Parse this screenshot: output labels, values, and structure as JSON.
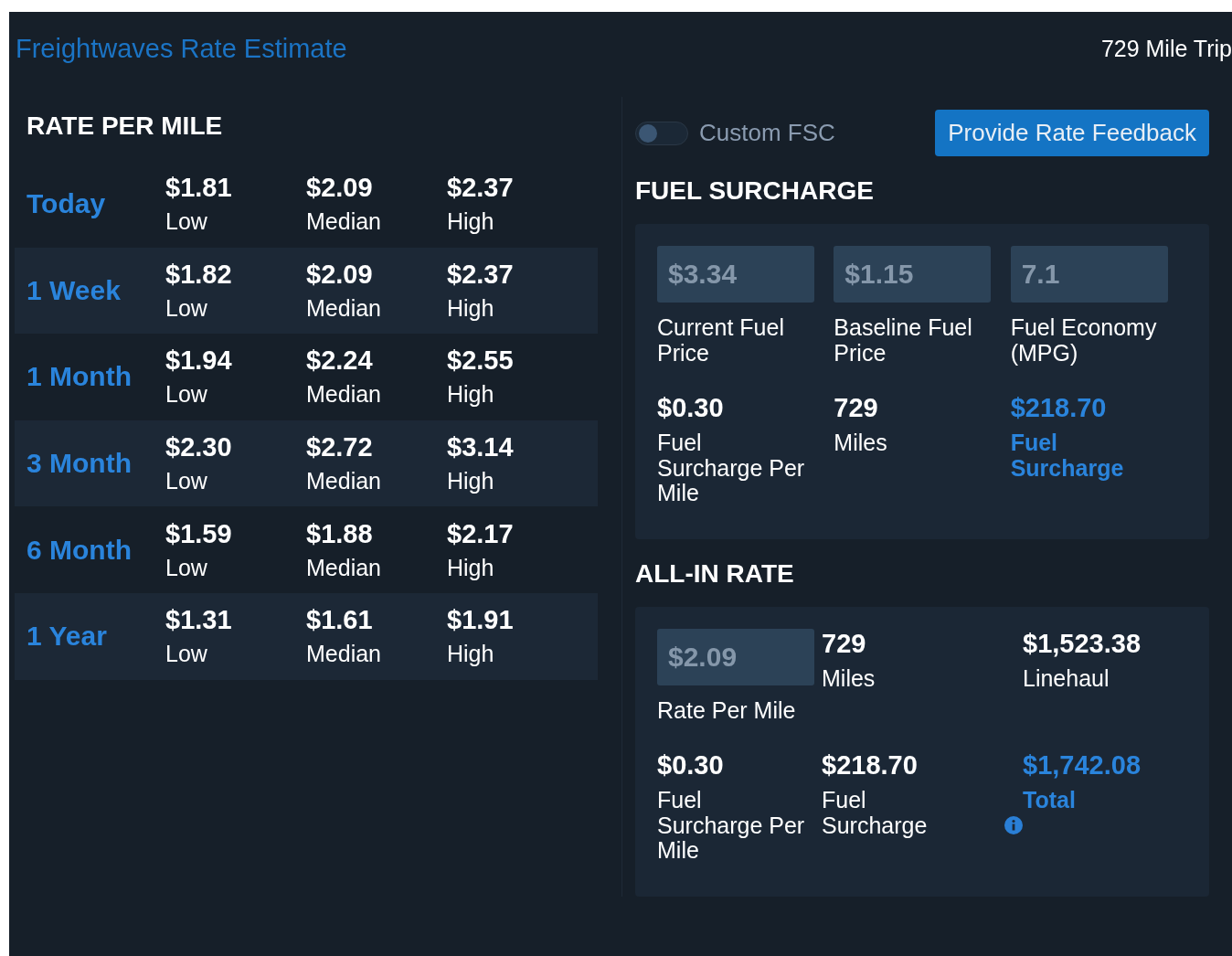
{
  "header": {
    "title": "Freightwaves Rate Estimate",
    "trip": "729 Mile Trip"
  },
  "rate_per_mile": {
    "heading": "RATE PER MILE",
    "rows": [
      {
        "period": "Today",
        "low": "$1.81",
        "low_label": "Low",
        "median": "$2.09",
        "median_label": "Median",
        "high": "$2.37",
        "high_label": "High",
        "selected": false
      },
      {
        "period": "1 Week",
        "low": "$1.82",
        "low_label": "Low",
        "median": "$2.09",
        "median_label": "Median",
        "high": "$2.37",
        "high_label": "High",
        "selected": true
      },
      {
        "period": "1 Month",
        "low": "$1.94",
        "low_label": "Low",
        "median": "$2.24",
        "median_label": "Median",
        "high": "$2.55",
        "high_label": "High",
        "selected": false
      },
      {
        "period": "3 Month",
        "low": "$2.30",
        "low_label": "Low",
        "median": "$2.72",
        "median_label": "Median",
        "high": "$3.14",
        "high_label": "High",
        "selected": true
      },
      {
        "period": "6 Month",
        "low": "$1.59",
        "low_label": "Low",
        "median": "$1.88",
        "median_label": "Median",
        "high": "$2.17",
        "high_label": "High",
        "selected": false
      },
      {
        "period": "1 Year",
        "low": "$1.31",
        "low_label": "Low",
        "median": "$1.61",
        "median_label": "Median",
        "high": "$1.91",
        "high_label": "High",
        "selected": true
      }
    ]
  },
  "custom_fsc": {
    "label": "Custom FSC",
    "on": false
  },
  "feedback_button": "Provide Rate Feedback",
  "fuel_surcharge": {
    "heading": "FUEL SURCHARGE",
    "items": [
      {
        "kind": "input",
        "prefix": "$",
        "value": "3.34",
        "label": "Current Fuel Price"
      },
      {
        "kind": "input",
        "prefix": "$",
        "value": "1.15",
        "label": "Baseline Fuel Price"
      },
      {
        "kind": "input",
        "value": "7.1",
        "label": "Fuel Economy (MPG)"
      },
      {
        "kind": "stat",
        "value": "$0.30",
        "label": "Fuel Surcharge Per Mile",
        "highlight": false
      },
      {
        "kind": "stat",
        "value": "729",
        "label": "Miles",
        "highlight": false
      },
      {
        "kind": "stat",
        "value": "$218.70",
        "label": "Fuel Surcharge",
        "highlight": true
      }
    ]
  },
  "all_in_rate": {
    "heading": "ALL-IN RATE",
    "items": [
      {
        "kind": "input",
        "prefix": "$",
        "value": "2.09",
        "label": "Rate Per Mile"
      },
      {
        "kind": "stat",
        "value": "729",
        "label": "Miles",
        "highlight": false
      },
      {
        "kind": "stat",
        "value": "$1,523.38",
        "label": "Linehaul",
        "highlight": false
      },
      {
        "kind": "stat",
        "value": "$0.30",
        "label": "Fuel Surcharge Per Mile",
        "highlight": false
      },
      {
        "kind": "stat",
        "value": "$218.70",
        "label": "Fuel Surcharge",
        "highlight": false,
        "info": true
      },
      {
        "kind": "stat",
        "value": "$1,742.08",
        "label": "Total",
        "highlight": true
      }
    ]
  }
}
